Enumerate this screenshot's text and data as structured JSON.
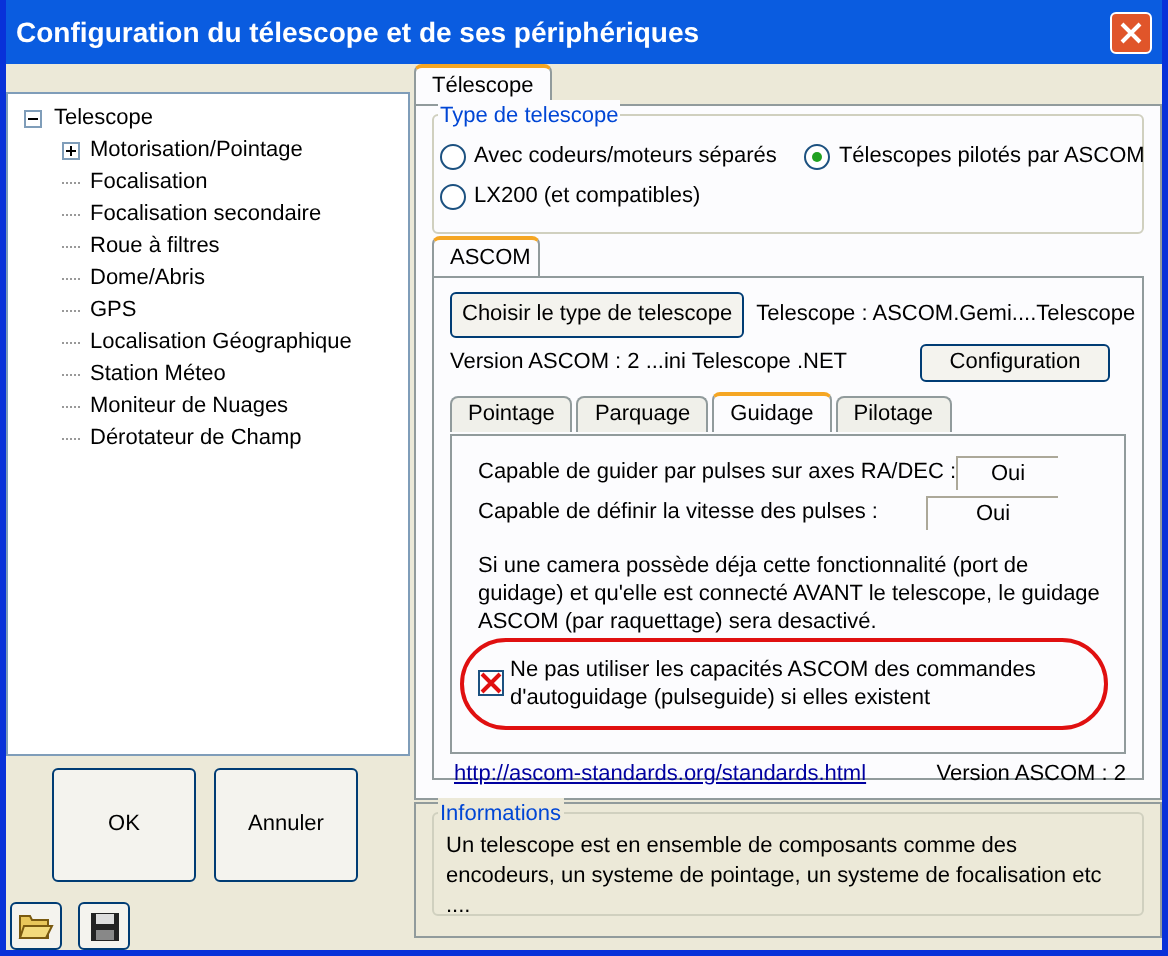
{
  "window": {
    "title": "Configuration du télescope et de ses périphériques"
  },
  "tree": {
    "label": "Telescope",
    "expanded": true,
    "children": [
      {
        "label": "Motorisation/Pointage",
        "kind": "branch",
        "expanded": false
      },
      {
        "label": "Focalisation",
        "kind": "leaf"
      },
      {
        "label": "Focalisation secondaire",
        "kind": "leaf"
      },
      {
        "label": "Roue à filtres",
        "kind": "leaf"
      },
      {
        "label": "Dome/Abris",
        "kind": "leaf"
      },
      {
        "label": "GPS",
        "kind": "leaf"
      },
      {
        "label": "Localisation Géographique",
        "kind": "leaf"
      },
      {
        "label": "Station Méteo",
        "kind": "leaf"
      },
      {
        "label": "Moniteur de Nuages",
        "kind": "leaf"
      },
      {
        "label": "Dérotateur de Champ",
        "kind": "leaf"
      }
    ]
  },
  "buttons": [
    "OK",
    "Annuler"
  ],
  "tabs": [
    {
      "label": "Télescope",
      "selected": true
    }
  ],
  "type_group": {
    "title": "Type de telescope",
    "options": [
      {
        "label": "Avec codeurs/moteurs séparés",
        "selected": false
      },
      {
        "label": "Télescopes pilotés par ASCOM",
        "selected": true
      },
      {
        "label": "LX200 (et compatibles)",
        "selected": false
      }
    ]
  },
  "ascom_tabs": [
    {
      "label": "ASCOM",
      "selected": true
    }
  ],
  "choose_button": "Choisir le type de telescope",
  "telescope_label": "Telescope : ASCOM.Gemi....Telescope",
  "version_label": "Version ASCOM : 2 ...ini Telescope .NET",
  "configuration_button": "Configuration",
  "sub_tabs": [
    {
      "label": "Pointage",
      "selected": false
    },
    {
      "label": "Parquage",
      "selected": false
    },
    {
      "label": "Guidage",
      "selected": true
    },
    {
      "label": "Pilotage",
      "selected": false
    }
  ],
  "capabilities": [
    {
      "label": "Capable de guider par pulses  sur axes RA/DEC :",
      "value": "Oui"
    },
    {
      "label": "Capable de définir la vitesse des pulses :",
      "value": "Oui"
    }
  ],
  "note": "Si une camera possède déja cette fonctionnalité (port de guidage) et qu'elle est connecté AVANT le telescope, le guidage ASCOM (par raquettage) sera desactivé.",
  "checkbox": {
    "label": "Ne pas utiliser les capacités ASCOM des commandes d'autoguidage (pulseguide) si elles existent",
    "checked": true
  },
  "link": "http://ascom-standards.org/standards.html",
  "version_footer": "Version ASCOM : 2",
  "informations": {
    "title": "Informations",
    "text": "Un telescope est en ensemble de composants comme des encodeurs, un systeme de pointage, un systeme de focalisation etc ...."
  }
}
